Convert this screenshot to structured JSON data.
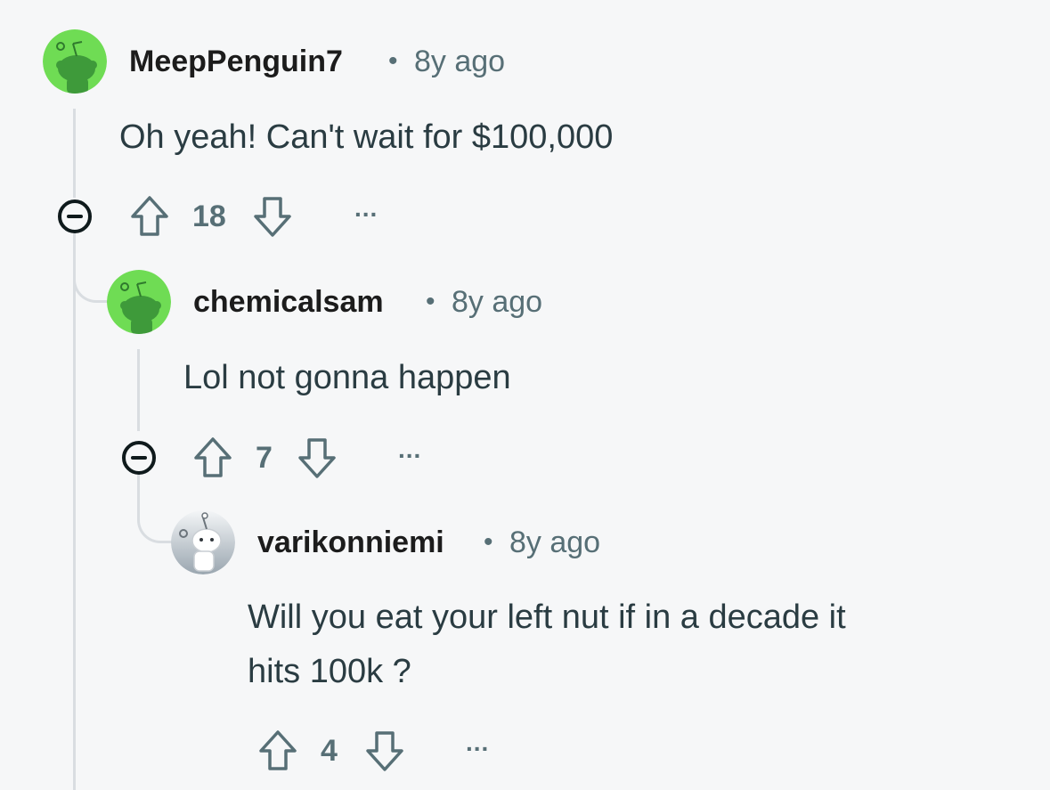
{
  "comments": [
    {
      "username": "MeepPenguin7",
      "time": "8y ago",
      "separator": "•",
      "body_lines": [
        "Oh yeah! Can't wait for $100,000"
      ],
      "score": "18",
      "more": "..."
    },
    {
      "username": "chemicalsam",
      "time": "8y ago",
      "separator": "•",
      "body_lines": [
        "Lol not gonna happen"
      ],
      "score": "7",
      "more": "..."
    },
    {
      "username": "varikonniemi",
      "time": "8y ago",
      "separator": "•",
      "body_lines": [
        "Will you eat your left nut if in a decade it",
        "hits 100k ?"
      ],
      "score": "4",
      "more": "..."
    }
  ],
  "colors": {
    "background": "#f6f7f8",
    "avatar_green": "#6fdc54",
    "meta_gray": "#576f76",
    "thread_line": "#d9dde1"
  }
}
